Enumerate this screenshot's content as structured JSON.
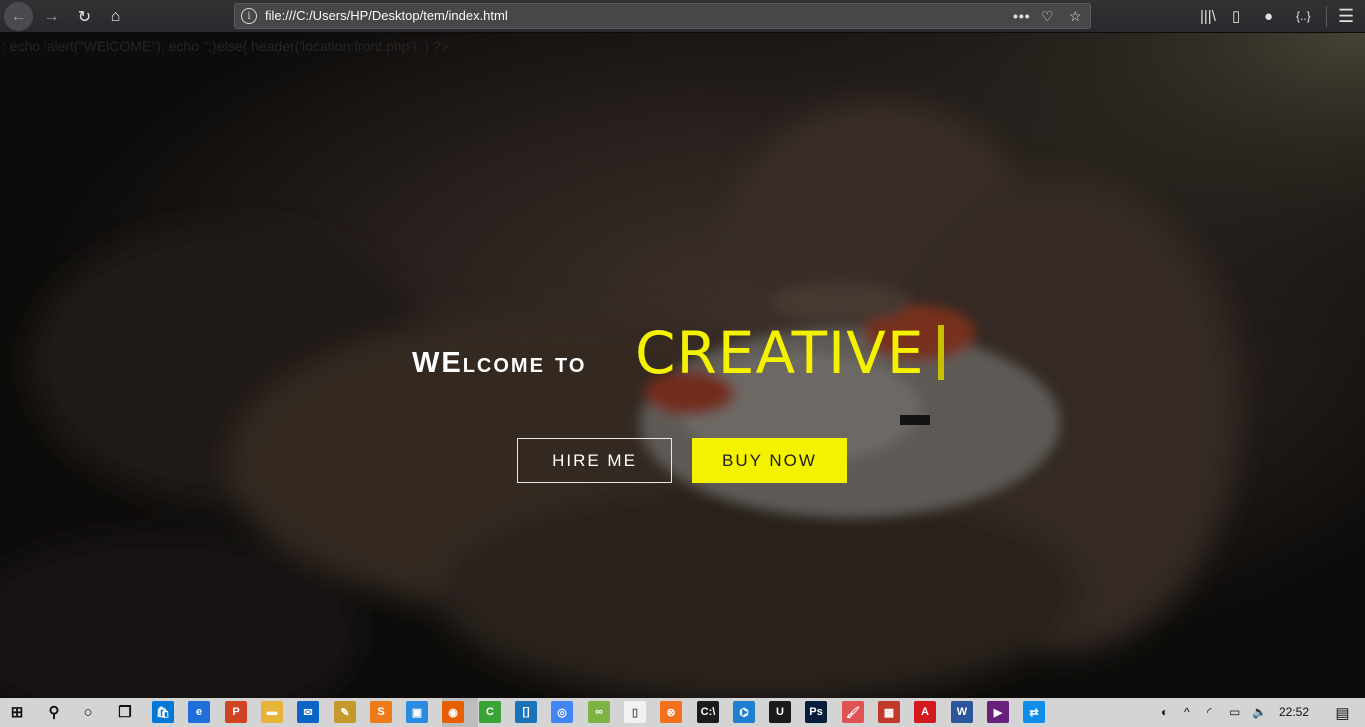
{
  "browser": {
    "url": "file:///C:/Users/HP/Desktop/tem/index.html",
    "icons": {
      "back": "←",
      "forward": "→",
      "reload": "↻",
      "home": "⌂",
      "more": "•••",
      "pocket": "♡",
      "star": "☆",
      "library": "|||\\",
      "sidebar": "▯",
      "account": "●",
      "extension": "{..}",
      "menu": "☰",
      "info": "i"
    }
  },
  "page": {
    "php_leak": "; echo 'alert(\"WElCOME\"); echo '';}else{ header('location:front.php'); } ?>",
    "welcome": "WElcome to",
    "brand": "CREATIVE",
    "hire_label": "HIRE ME",
    "buy_label": "BUY NOW",
    "accent_color": "#f5f200"
  },
  "taskbar": {
    "clock": "22:52",
    "start": "⊞",
    "search": "⚲",
    "cortana": "○",
    "taskview": "❐",
    "tray_up": "^",
    "volume": "🔈",
    "notifications": "▤",
    "apps": [
      {
        "name": "store",
        "glyph": "🛍",
        "color": "#0078d7"
      },
      {
        "name": "edge",
        "glyph": "e",
        "color": "#1e6fd9"
      },
      {
        "name": "powerpoint",
        "glyph": "P",
        "color": "#d04423"
      },
      {
        "name": "file-explorer",
        "glyph": "▬",
        "color": "#e8b339"
      },
      {
        "name": "mail",
        "glyph": "✉",
        "color": "#0a64c6"
      },
      {
        "name": "settings-app",
        "glyph": "✎",
        "color": "#c59a2d"
      },
      {
        "name": "sublime",
        "glyph": "S",
        "color": "#ee7b18"
      },
      {
        "name": "photos",
        "glyph": "▣",
        "color": "#2a8be0"
      },
      {
        "name": "firefox",
        "glyph": "◉",
        "color": "#e66000"
      },
      {
        "name": "camtasia",
        "glyph": "C",
        "color": "#3aa335"
      },
      {
        "name": "bracket-app",
        "glyph": "[]",
        "color": "#1a72b8"
      },
      {
        "name": "chrome",
        "glyph": "◎",
        "color": "#4285f4"
      },
      {
        "name": "android",
        "glyph": "∞",
        "color": "#7cb342"
      },
      {
        "name": "notepad",
        "glyph": "▯",
        "color": "#f2f2f2"
      },
      {
        "name": "xampp",
        "glyph": "⊗",
        "color": "#f56f1d"
      },
      {
        "name": "cmd",
        "glyph": "C:\\",
        "color": "#1b1b1b"
      },
      {
        "name": "vscode",
        "glyph": "⌬",
        "color": "#1f7ecf"
      },
      {
        "name": "upwork",
        "glyph": "U",
        "color": "#1a1a1a"
      },
      {
        "name": "photoshop",
        "glyph": "Ps",
        "color": "#061e3b"
      },
      {
        "name": "paint",
        "glyph": "🖌",
        "color": "#e15252"
      },
      {
        "name": "colors-app",
        "glyph": "▦",
        "color": "#c0392b"
      },
      {
        "name": "acrobat",
        "glyph": "A",
        "color": "#d4191e"
      },
      {
        "name": "word",
        "glyph": "W",
        "color": "#2b579a"
      },
      {
        "name": "visual-studio",
        "glyph": "▶",
        "color": "#68217a"
      },
      {
        "name": "teamviewer",
        "glyph": "⇄",
        "color": "#0e8ee9"
      }
    ]
  }
}
